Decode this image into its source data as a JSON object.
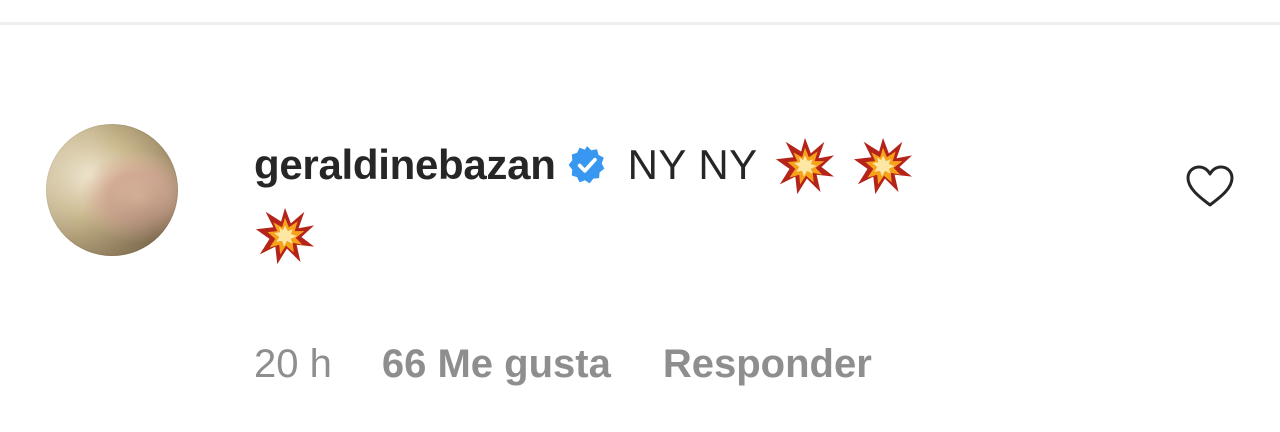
{
  "comment": {
    "username": "geraldinebazan",
    "verified": true,
    "text": "NY NY",
    "emojis": [
      "collision-emoji",
      "collision-emoji",
      "collision-emoji"
    ],
    "time": "20 h",
    "likes": "66 Me gusta",
    "reply_label": "Responder"
  },
  "colors": {
    "text": "#262626",
    "meta": "#8e8e8e",
    "verified_blue": "#3897f0"
  }
}
